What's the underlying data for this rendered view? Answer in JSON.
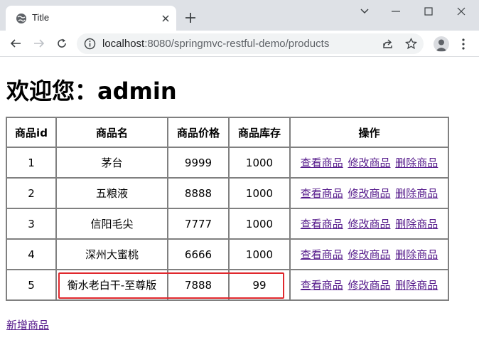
{
  "browser": {
    "tab_title": "Title",
    "url_host": "localhost",
    "url_rest": ":8080/springmvc-restful-demo/products"
  },
  "page": {
    "welcome": "欢迎您：admin",
    "table": {
      "headers": [
        "商品id",
        "商品名",
        "商品价格",
        "商品库存",
        "操作"
      ],
      "rows": [
        {
          "id": "1",
          "name": "茅台",
          "price": "9999",
          "stock": "1000"
        },
        {
          "id": "2",
          "name": "五粮液",
          "price": "8888",
          "stock": "1000"
        },
        {
          "id": "3",
          "name": "信阳毛尖",
          "price": "7777",
          "stock": "1000"
        },
        {
          "id": "4",
          "name": "深州大蜜桃",
          "price": "6666",
          "stock": "1000"
        },
        {
          "id": "5",
          "name": "衡水老白干-至尊版",
          "price": "7888",
          "stock": "99"
        }
      ],
      "actions": {
        "view": "查看商品",
        "edit": "修改商品",
        "delete": "删除商品"
      }
    },
    "add_link": "新增商品"
  },
  "colors": {
    "link": "#551a8b",
    "highlight_border": "#e0282d",
    "chrome_bg": "#dee1e6"
  }
}
